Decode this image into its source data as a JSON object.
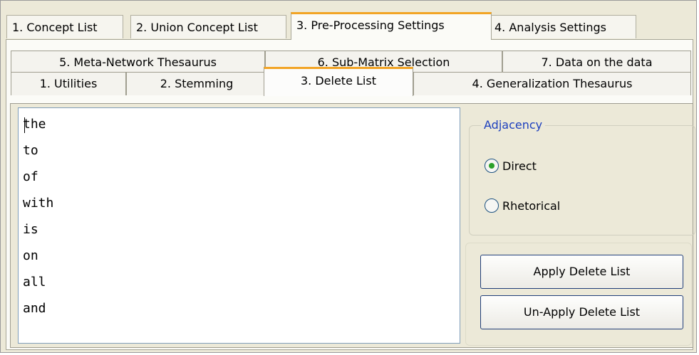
{
  "top_tabs": [
    {
      "label": "1. Concept List",
      "active": false
    },
    {
      "label": "2. Union Concept List",
      "active": false
    },
    {
      "label": "3. Pre-Processing Settings",
      "active": true
    },
    {
      "label": "4. Analysis Settings",
      "active": false
    }
  ],
  "sub_tabs": {
    "row1": [
      {
        "label": "5. Meta-Network Thesaurus"
      },
      {
        "label": "6. Sub-Matrix Selection"
      },
      {
        "label": "7. Data on the data"
      }
    ],
    "row2": [
      {
        "label": "1. Utilities",
        "active": false
      },
      {
        "label": "2. Stemming",
        "active": false
      },
      {
        "label": "3. Delete List",
        "active": true
      },
      {
        "label": "4. Generalization Thesaurus",
        "active": false
      }
    ]
  },
  "delete_list": {
    "words": [
      "the",
      "to",
      "of",
      "with",
      "is",
      "on",
      "all",
      "and"
    ]
  },
  "adjacency": {
    "title": "Adjacency",
    "options": [
      {
        "label": "Direct",
        "selected": true
      },
      {
        "label": "Rhetorical",
        "selected": false
      }
    ]
  },
  "buttons": {
    "apply": "Apply Delete List",
    "unapply": "Un-Apply Delete List"
  },
  "colors": {
    "active_tab_accent": "#f2a424",
    "group_title": "#1c3fbe",
    "radio_dot": "#2aa12a"
  }
}
